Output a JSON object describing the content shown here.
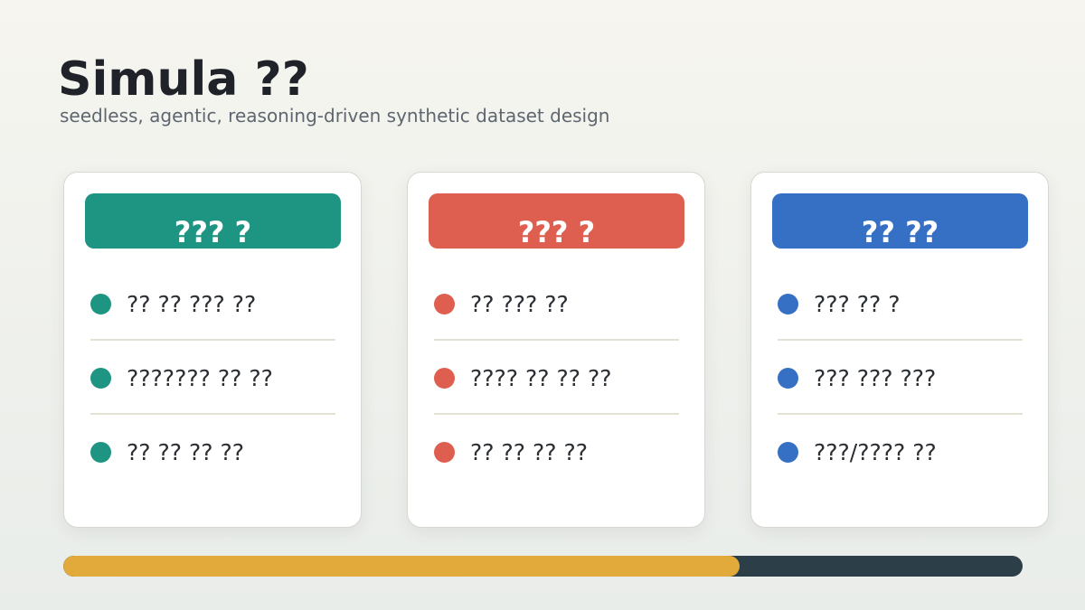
{
  "slide": {
    "title": "Simula ??",
    "subtitle": "seedless, agentic, reasoning-driven synthetic dataset design"
  },
  "cards": [
    {
      "header": "??? ?",
      "color": "#1e9583",
      "items": [
        "?? ?? ??? ??",
        "??????? ?? ??",
        "?? ?? ?? ??"
      ]
    },
    {
      "header": "??? ?",
      "color": "#de5f4f",
      "items": [
        "?? ??? ??",
        "???? ?? ?? ??",
        "?? ?? ?? ??"
      ]
    },
    {
      "header": "?? ??",
      "color": "#3670c4",
      "items": [
        "??? ?? ?",
        "??? ??? ???",
        "???/???? ??"
      ]
    }
  ],
  "progress": {
    "fraction": 0.705,
    "fill_color": "#e2a93b",
    "track_color": "#2c3f48"
  }
}
